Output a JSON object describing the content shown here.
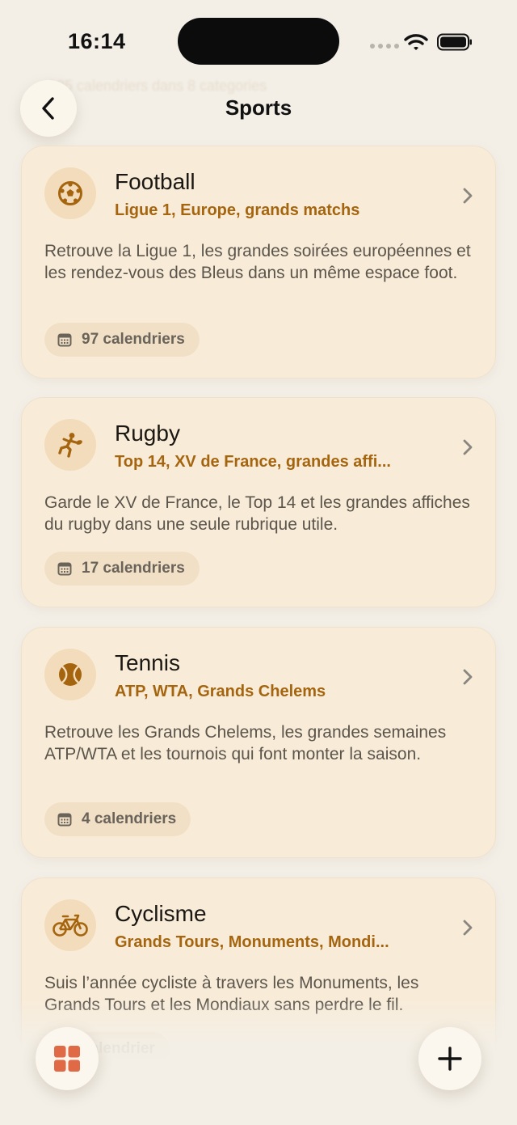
{
  "status_bar": {
    "time": "16:14"
  },
  "background_hint": {
    "text": "125 calendriers dans 8 categories"
  },
  "header": {
    "title": "Sports"
  },
  "categories": [
    {
      "title": "Football",
      "subtitle": "Ligue 1, Europe, grands matchs",
      "description": "Retrouve la Ligue 1, les grandes soirées européennes et les rendez-vous des Bleus dans un même espace foot.",
      "count_label": "97 calendriers",
      "icon": "soccer-ball-icon"
    },
    {
      "title": "Rugby",
      "subtitle": "Top 14, XV de France, grandes affi...",
      "description": "Garde le XV de France, le Top 14 et les grandes affiches du rugby dans une seule rubrique utile.",
      "count_label": "17 calendriers",
      "icon": "rugby-player-icon"
    },
    {
      "title": "Tennis",
      "subtitle": "ATP, WTA, Grands Chelems",
      "description": "Retrouve les Grands Chelems, les grandes semaines ATP/WTA et les tournois qui font monter la saison.",
      "count_label": "4 calendriers",
      "icon": "tennis-ball-icon"
    },
    {
      "title": "Cyclisme",
      "subtitle": "Grands Tours, Monuments, Mondi...",
      "description": "Suis l’année cycliste à travers les Monuments, les Grands Tours et les Mondiaux sans perdre le fil.",
      "count_label": "calendrier",
      "icon": "bicycle-icon"
    }
  ],
  "colors": {
    "accent": "#a5650f",
    "card_bg": "#f8ecd9",
    "icon_bg": "#f2dcbb",
    "grid_icon": "#e06a45"
  }
}
